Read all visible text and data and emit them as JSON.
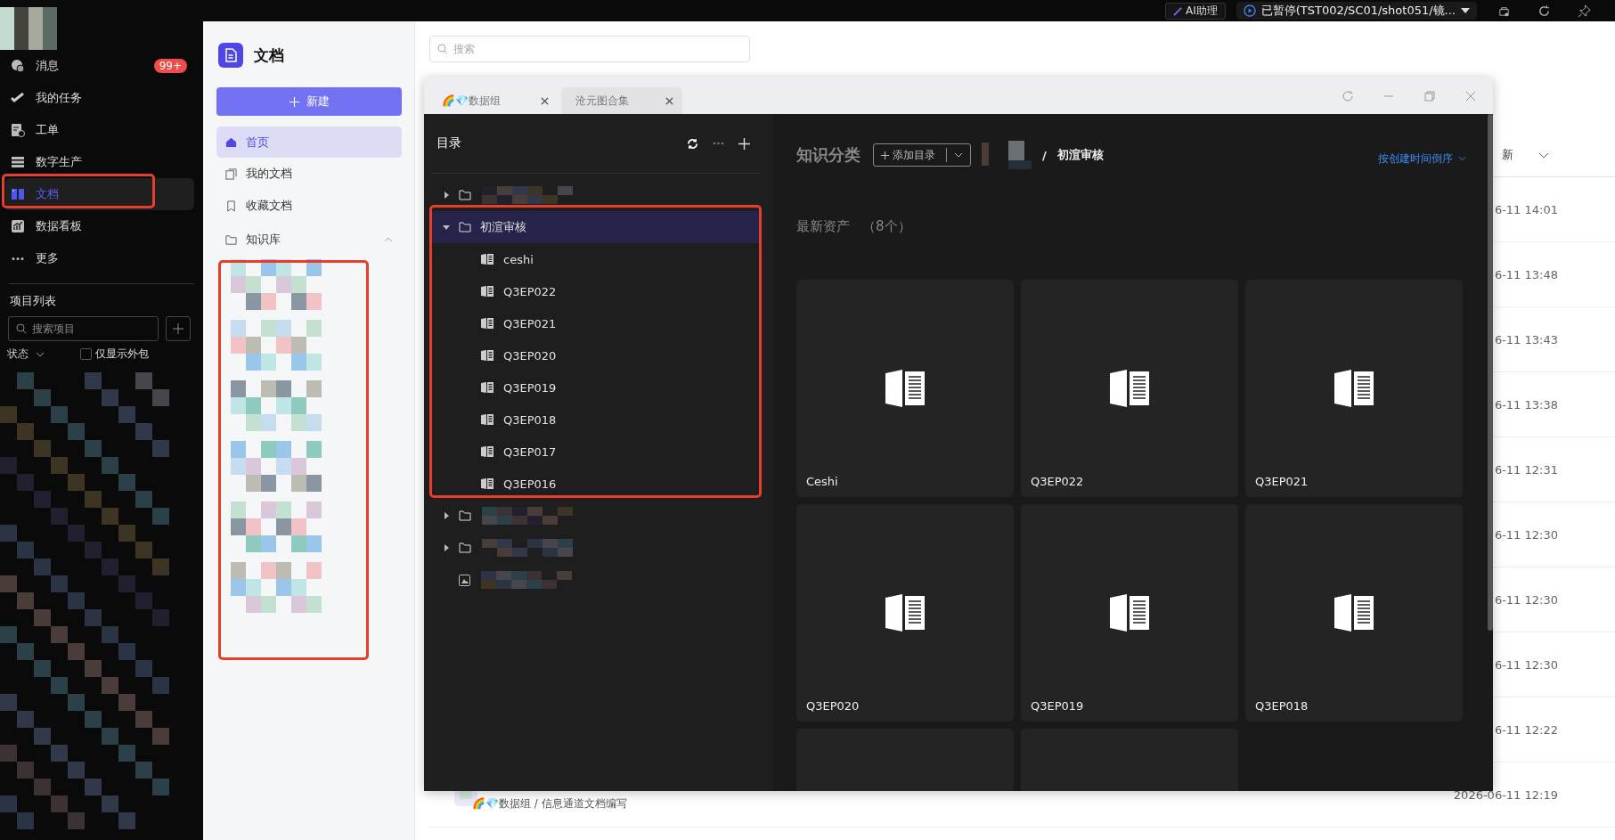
{
  "topbar": {
    "ai_button": "AI助理",
    "status": "已暂停(TST002/SC01/shot051/镜..."
  },
  "nav": {
    "items": [
      {
        "label": "消息",
        "badge": "99+",
        "selected": false
      },
      {
        "label": "我的任务",
        "selected": false
      },
      {
        "label": "工单",
        "selected": false
      },
      {
        "label": "数字生产",
        "selected": false
      },
      {
        "label": "文档",
        "selected": true
      },
      {
        "label": "数据看板",
        "selected": false
      },
      {
        "label": "更多",
        "selected": false
      }
    ]
  },
  "project_list": {
    "title": "项目列表",
    "search": {
      "placeholder": "搜索项目"
    },
    "status_filter": "状态",
    "outsourced_only": {
      "label": "仅显示外包",
      "checked": false
    }
  },
  "docs_panel": {
    "title": "文档",
    "new_button": "新建",
    "items": [
      {
        "label": "首页",
        "selected": true
      },
      {
        "label": "我的文档",
        "selected": false
      },
      {
        "label": "收藏文档",
        "selected": false
      }
    ],
    "knowledge_base": {
      "label": "知识库",
      "expanded": true
    }
  },
  "search": {
    "placeholder": "搜索"
  },
  "table": {
    "header": "新",
    "rows": [
      {
        "time": "6-11 14:01"
      },
      {
        "time": "6-11 13:48"
      },
      {
        "time": "6-11 13:43"
      },
      {
        "time": "6-11 13:38"
      },
      {
        "time": "6-11 12:31"
      },
      {
        "time": "6-11 12:30"
      },
      {
        "time": "6-11 12:30"
      },
      {
        "time": "6-11 12:30"
      },
      {
        "time": "6-11 12:22"
      },
      {
        "path": "🌈💎数据组 / 信息通道文档编写",
        "time": "2026-06-11 12:19"
      }
    ]
  },
  "dialog": {
    "tabs": [
      {
        "label": "🌈💎数据组",
        "selected": false
      },
      {
        "label": "沧元图合集",
        "selected": true
      }
    ],
    "tree": {
      "title": "目录",
      "nodes": [
        {
          "kind": "folder",
          "expanded": false,
          "selected": false
        },
        {
          "kind": "folder",
          "label": "初渲审核",
          "expanded": true,
          "selected": true,
          "children": [
            {
              "kind": "doc",
              "label": "ceshi",
              "selected": false
            },
            {
              "kind": "doc",
              "label": "Q3EP022",
              "selected": false
            },
            {
              "kind": "doc",
              "label": "Q3EP021",
              "selected": false
            },
            {
              "kind": "doc",
              "label": "Q3EP020",
              "selected": false
            },
            {
              "kind": "doc",
              "label": "Q3EP019",
              "selected": false
            },
            {
              "kind": "doc",
              "label": "Q3EP018",
              "selected": false
            },
            {
              "kind": "doc",
              "label": "Q3EP017",
              "selected": false
            },
            {
              "kind": "doc",
              "label": "Q3EP016",
              "selected": false
            }
          ]
        },
        {
          "kind": "folder",
          "expanded": false,
          "selected": false
        },
        {
          "kind": "folder",
          "expanded": false,
          "selected": false
        },
        {
          "kind": "image",
          "selected": false
        }
      ]
    },
    "category": {
      "title": "知识分类",
      "add_button": "添加目录",
      "separator": "/",
      "current": "初渲审核",
      "sort": "按创建时间倒序"
    },
    "assets": {
      "title": "最新资产",
      "count": "（8个）",
      "items": [
        {
          "kind": "doc",
          "name": "Ceshi"
        },
        {
          "kind": "doc",
          "name": "Q3EP022"
        },
        {
          "kind": "doc",
          "name": "Q3EP021"
        },
        {
          "kind": "doc",
          "name": "Q3EP020"
        },
        {
          "kind": "doc",
          "name": "Q3EP019"
        },
        {
          "kind": "doc",
          "name": "Q3EP018"
        },
        {
          "kind": "cut"
        },
        {
          "kind": "cut"
        }
      ]
    }
  }
}
